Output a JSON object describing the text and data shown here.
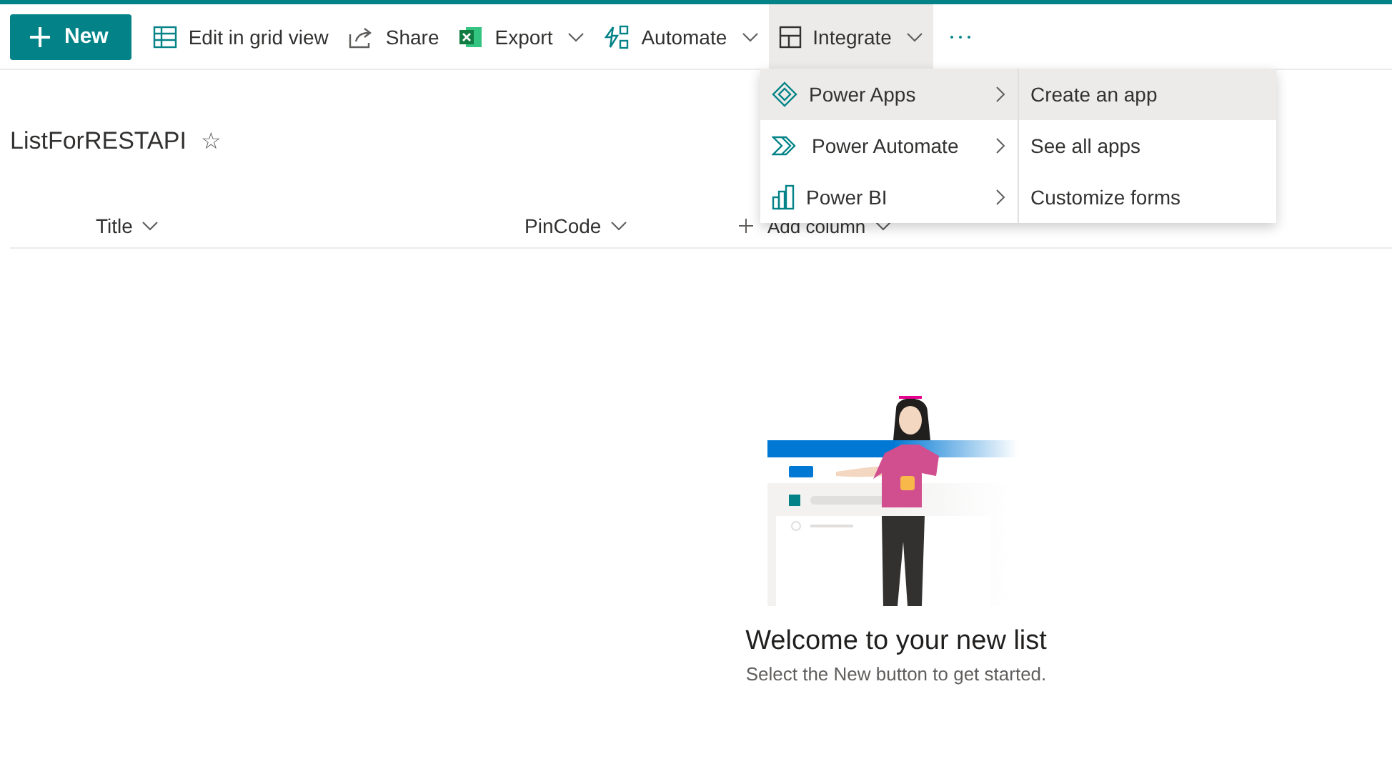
{
  "toolbar": {
    "items": [
      {
        "kind": "new",
        "label": "New",
        "has_menu": false,
        "expanded": false
      },
      {
        "kind": "grid",
        "label": "Edit in grid view",
        "has_menu": false,
        "expanded": false
      },
      {
        "kind": "share",
        "label": "Share",
        "has_menu": false,
        "expanded": false
      },
      {
        "kind": "export",
        "label": "Export",
        "has_menu": true,
        "expanded": false
      },
      {
        "kind": "automate",
        "label": "Automate",
        "has_menu": true,
        "expanded": false
      },
      {
        "kind": "integrate",
        "label": "Integrate",
        "has_menu": true,
        "expanded": true
      },
      {
        "kind": "more",
        "has_menu": false,
        "expanded": false
      }
    ]
  },
  "list": {
    "title": "ListForRESTAPI",
    "favorite_glyph": "☆",
    "columns": [
      {
        "kind": "column",
        "label": "Title"
      },
      {
        "kind": "column",
        "label": "PinCode"
      },
      {
        "kind": "add",
        "label": "Add column"
      }
    ]
  },
  "integrate_menu": {
    "items": [
      {
        "kind": "apps",
        "label": "Power Apps",
        "selected": true
      },
      {
        "kind": "flow",
        "label": "Power Automate",
        "selected": false
      },
      {
        "kind": "bi",
        "label": "Power BI",
        "selected": false
      }
    ],
    "submenu": [
      {
        "label": "Create an app",
        "selected": true
      },
      {
        "label": "See all apps",
        "selected": false
      },
      {
        "label": "Customize forms",
        "selected": false
      }
    ]
  },
  "empty_state": {
    "heading": "Welcome to your new list",
    "hint": "Select the New button to get started."
  }
}
